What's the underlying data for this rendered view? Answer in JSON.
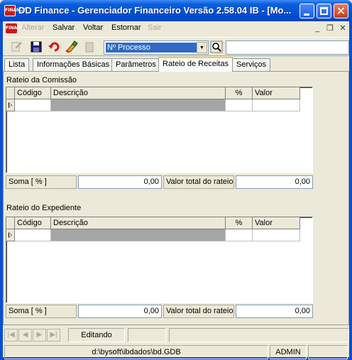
{
  "window": {
    "title": "DD Finance - Gerenciador Financeiro Versão 2.58.04 IB - [Mo...",
    "app_icon_text": "FINANCE"
  },
  "menu": {
    "items": [
      "Alterar",
      "Salvar",
      "Voltar",
      "Estornar",
      "Sair"
    ]
  },
  "toolbar": {
    "process_select_value": "Nº Processo",
    "search_value": ""
  },
  "tabs": [
    "Lista",
    "Informações Básicas",
    "Parâmetros",
    "Rateio de Receitas",
    "Serviços"
  ],
  "active_tab": "Rateio de Receitas",
  "comissao": {
    "title": "Rateio da Comissão",
    "columns": [
      "Código",
      "Descrição",
      "%",
      "Valor"
    ],
    "soma_label": "Soma  [ % ]",
    "soma_value": "0,00",
    "total_label": "Valor total do rateio",
    "total_value": "0,00"
  },
  "expediente": {
    "title": "Rateio do Expediente",
    "columns": [
      "Código",
      "Descrição",
      "%",
      "Valor"
    ],
    "soma_label": "Soma  [ % ]",
    "soma_value": "0,00",
    "total_label": "Valor total do rateio",
    "total_value": "0,00"
  },
  "status": {
    "mode": "Editando",
    "path": "d:\\bysoft\\ibdados\\bd.GDB",
    "user": "ADMIN"
  },
  "colors": {
    "titlebar": "#0a5ddc",
    "selection": "#316ac5",
    "grid_gray": "#a5a5a5"
  }
}
